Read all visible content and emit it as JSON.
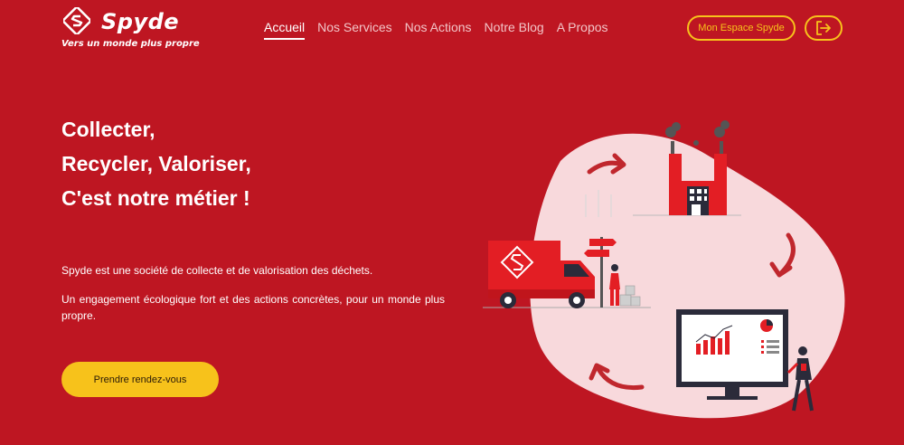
{
  "brand": {
    "name": "Spyde",
    "tagline": "Vers un monde plus propre"
  },
  "nav": {
    "items": [
      {
        "label": "Accueil",
        "active": true
      },
      {
        "label": "Nos Services",
        "active": false
      },
      {
        "label": "Nos Actions",
        "active": false
      },
      {
        "label": "Notre Blog",
        "active": false
      },
      {
        "label": "A Propos",
        "active": false
      }
    ]
  },
  "header": {
    "space_button": "Mon Espace Spyde",
    "logout_icon": "logout-icon"
  },
  "hero": {
    "title_lines": [
      "Collecter,",
      "Recycler, Valoriser,",
      "C'est notre métier !"
    ],
    "paragraph1": "Spyde est une société de collecte et de valorisation des déchets.",
    "paragraph2": "Un engagement écologique fort et des actions concrètes, pour un monde plus propre.",
    "cta": "Prendre rendez-vous"
  },
  "colors": {
    "background": "#be1622",
    "accent": "#f7c21b",
    "blob": "#f8d9dc",
    "illustration_red": "#e31e24"
  }
}
